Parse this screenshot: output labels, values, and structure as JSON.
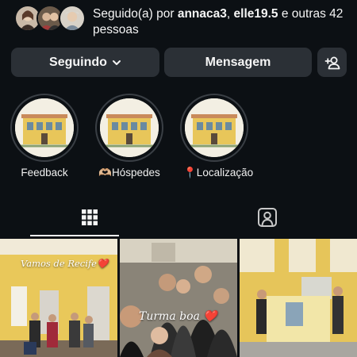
{
  "followed_by": {
    "prefix": "Seguido(a) por ",
    "user1": "annaca3",
    "separator": ", ",
    "user2": "elle19.5",
    "suffix": " e outras 42 pessoas"
  },
  "buttons": {
    "following": "Seguindo",
    "message": "Mensagem"
  },
  "highlights": [
    {
      "label": "Feedback"
    },
    {
      "label": "🫶🏼Hóspedes"
    },
    {
      "label": "📍Localização"
    }
  ],
  "tabs": {
    "grid_icon": "grid-icon",
    "tagged_icon": "tagged-person-icon"
  },
  "posts": [
    {
      "caption": "Vamos de Recife❤️"
    },
    {
      "caption": "Turma boa ❤️"
    },
    {
      "caption": ""
    }
  ],
  "colors": {
    "background": "#0c1014",
    "button": "#2b3036",
    "text": "#f5f5f5"
  }
}
